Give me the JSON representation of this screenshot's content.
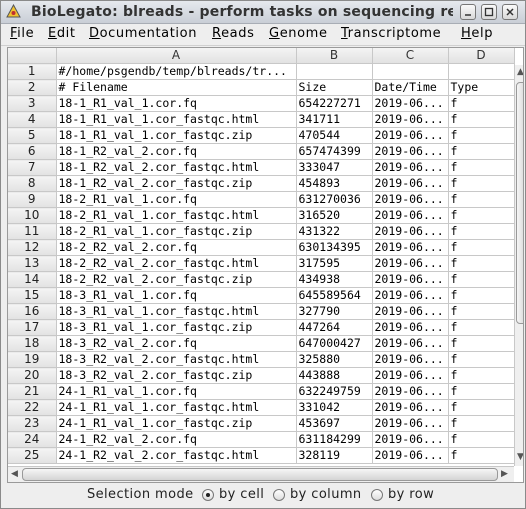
{
  "window": {
    "title": "BioLegato: blreads - perform tasks on sequencing read",
    "controls": [
      "minimize-icon",
      "maximize-icon",
      "close-icon"
    ]
  },
  "menu": {
    "items": [
      {
        "label": "File",
        "mnemonic": "F",
        "rest": "ile"
      },
      {
        "label": "Edit",
        "mnemonic": "E",
        "rest": "dit"
      },
      {
        "label": "Documentation",
        "mnemonic": "D",
        "rest": "ocumentation"
      },
      {
        "label": "Reads",
        "mnemonic": "R",
        "rest": "eads"
      },
      {
        "label": "Genome",
        "mnemonic": "G",
        "rest": "enome"
      },
      {
        "label": "Transcriptome",
        "mnemonic": "T",
        "rest": "ranscriptome"
      },
      {
        "label": "Help",
        "mnemonic": "H",
        "rest": "elp"
      }
    ]
  },
  "grid": {
    "columns": [
      "A",
      "B",
      "C",
      "D"
    ],
    "rows": [
      [
        "1",
        "#/home/psgendb/temp/blreads/tr...",
        "",
        "",
        ""
      ],
      [
        "2",
        "# Filename",
        "Size",
        "Date/Time",
        "Type"
      ],
      [
        "3",
        "18-1_R1_val_1.cor.fq",
        "654227271",
        "2019-06...",
        "f"
      ],
      [
        "4",
        "18-1_R1_val_1.cor_fastqc.html",
        "341711",
        "2019-06...",
        "f"
      ],
      [
        "5",
        "18-1_R1_val_1.cor_fastqc.zip",
        "470544",
        "2019-06...",
        "f"
      ],
      [
        "6",
        "18-1_R2_val_2.cor.fq",
        "657474399",
        "2019-06...",
        "f"
      ],
      [
        "7",
        "18-1_R2_val_2.cor_fastqc.html",
        "333047",
        "2019-06...",
        "f"
      ],
      [
        "8",
        "18-1_R2_val_2.cor_fastqc.zip",
        "454893",
        "2019-06...",
        "f"
      ],
      [
        "9",
        "18-2_R1_val_1.cor.fq",
        "631270036",
        "2019-06...",
        "f"
      ],
      [
        "10",
        "18-2_R1_val_1.cor_fastqc.html",
        "316520",
        "2019-06...",
        "f"
      ],
      [
        "11",
        "18-2_R1_val_1.cor_fastqc.zip",
        "431322",
        "2019-06...",
        "f"
      ],
      [
        "12",
        "18-2_R2_val_2.cor.fq",
        "630134395",
        "2019-06...",
        "f"
      ],
      [
        "13",
        "18-2_R2_val_2.cor_fastqc.html",
        "317595",
        "2019-06...",
        "f"
      ],
      [
        "14",
        "18-2_R2_val_2.cor_fastqc.zip",
        "434938",
        "2019-06...",
        "f"
      ],
      [
        "15",
        "18-3_R1_val_1.cor.fq",
        "645589564",
        "2019-06...",
        "f"
      ],
      [
        "16",
        "18-3_R1_val_1.cor_fastqc.html",
        "327790",
        "2019-06...",
        "f"
      ],
      [
        "17",
        "18-3_R1_val_1.cor_fastqc.zip",
        "447264",
        "2019-06...",
        "f"
      ],
      [
        "18",
        "18-3_R2_val_2.cor.fq",
        "647000427",
        "2019-06...",
        "f"
      ],
      [
        "19",
        "18-3_R2_val_2.cor_fastqc.html",
        "325880",
        "2019-06...",
        "f"
      ],
      [
        "20",
        "18-3_R2_val_2.cor_fastqc.zip",
        "443888",
        "2019-06...",
        "f"
      ],
      [
        "21",
        "24-1_R1_val_1.cor.fq",
        "632249759",
        "2019-06...",
        "f"
      ],
      [
        "22",
        "24-1_R1_val_1.cor_fastqc.html",
        "331042",
        "2019-06...",
        "f"
      ],
      [
        "23",
        "24-1_R1_val_1.cor_fastqc.zip",
        "453697",
        "2019-06...",
        "f"
      ],
      [
        "24",
        "24-1_R2_val_2.cor.fq",
        "631184299",
        "2019-06...",
        "f"
      ],
      [
        "25",
        "24-1_R2_val_2.cor_fastqc.html",
        "328119",
        "2019-06...",
        "f"
      ]
    ]
  },
  "footer": {
    "label": "Selection mode",
    "options": [
      {
        "label": "by cell",
        "selected": true
      },
      {
        "label": "by column",
        "selected": false
      },
      {
        "label": "by row",
        "selected": false
      }
    ]
  }
}
